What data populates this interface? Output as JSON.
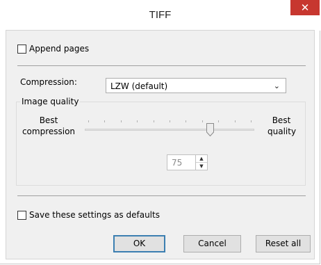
{
  "window": {
    "title": "TIFF",
    "close_glyph": "✕"
  },
  "options": {
    "append_pages_label": "Append pages",
    "append_pages_checked": false
  },
  "compression": {
    "label": "Compression:",
    "selected": "LZW (default)"
  },
  "image_quality": {
    "group_label": "Image quality",
    "left_label_line1": "Best",
    "left_label_line2": "compression",
    "right_label_line1": "Best",
    "right_label_line2": "quality",
    "slider_value_fraction": 0.75,
    "value": "75"
  },
  "defaults": {
    "label": "Save these settings as defaults",
    "checked": false
  },
  "buttons": {
    "ok": "OK",
    "cancel": "Cancel",
    "reset": "Reset all"
  },
  "colors": {
    "close_button": "#c7372f",
    "default_button_border": "#3c7fb1"
  },
  "icons": {
    "close": "close-icon",
    "dropdown": "chevron-down-icon",
    "spin_up": "arrow-up-icon",
    "spin_down": "arrow-down-icon"
  }
}
